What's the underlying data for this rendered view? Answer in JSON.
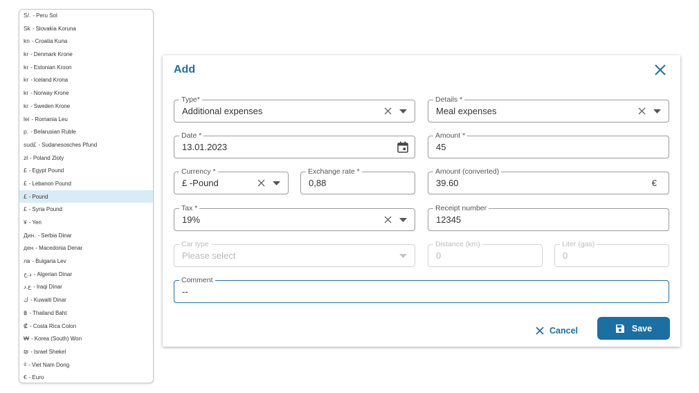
{
  "currency_list": {
    "selected_index": 14,
    "items": [
      {
        "symbol": "S/.",
        "name": "Peru Sol"
      },
      {
        "symbol": "Sk",
        "name": "Slovakia Koruna"
      },
      {
        "symbol": "kn",
        "name": "Croatia Kuna"
      },
      {
        "symbol": "kr",
        "name": "Denmark Krone"
      },
      {
        "symbol": "kr",
        "name": "Estonian Kroon"
      },
      {
        "symbol": "kr",
        "name": "Iceland Krona"
      },
      {
        "symbol": "kr",
        "name": "Norway Krone"
      },
      {
        "symbol": "kr",
        "name": "Sweden Krone"
      },
      {
        "symbol": "lei",
        "name": "Romania Leu"
      },
      {
        "symbol": "p.",
        "name": "Belarusian Ruble"
      },
      {
        "symbol": "sud£",
        "name": "Sudanesosches Pfund"
      },
      {
        "symbol": "zł",
        "name": "Poland Zloty"
      },
      {
        "symbol": "£",
        "name": "Egypt Pound"
      },
      {
        "symbol": "£",
        "name": "Lebanon Pound"
      },
      {
        "symbol": "£",
        "name": "Pound"
      },
      {
        "symbol": "£",
        "name": "Syria Pound"
      },
      {
        "symbol": "¥",
        "name": "Yen"
      },
      {
        "symbol": "Дин.",
        "name": "Serbia Dinar"
      },
      {
        "symbol": "ден",
        "name": "Macedonia Denar"
      },
      {
        "symbol": "лв",
        "name": "Bulgaria Lev"
      },
      {
        "symbol": "د.ج",
        "name": "Algerian Dinar"
      },
      {
        "symbol": "ع.د",
        "name": "Iraqi Dinar"
      },
      {
        "symbol": "ك",
        "name": "Kuwaiti Dinar"
      },
      {
        "symbol": "฿",
        "name": "Thailand Baht"
      },
      {
        "symbol": "₡",
        "name": "Costa Rica Colon"
      },
      {
        "symbol": "₩",
        "name": "Korea (South) Won"
      },
      {
        "symbol": "₪",
        "name": "Israel Shekel"
      },
      {
        "symbol": "₫",
        "name": "Viet Nam Dong"
      },
      {
        "symbol": "€",
        "name": "Euro"
      }
    ]
  },
  "dialog": {
    "title": "Add",
    "type": {
      "label": "Type*",
      "value": "Additional expenses"
    },
    "details": {
      "label": "Details *",
      "value": "Meal expenses"
    },
    "date": {
      "label": "Date *",
      "value": "13.01.2023"
    },
    "amount": {
      "label": "Amount *",
      "value": "45"
    },
    "currency": {
      "label": "Currency *",
      "value": "£ -Pound"
    },
    "exchange_rate": {
      "label": "Exchange rate *",
      "value": "0,88"
    },
    "amount_converted": {
      "label": "Amount (converted)",
      "value": "39.60",
      "suffix": "€"
    },
    "tax": {
      "label": "Tax *",
      "value": "19%"
    },
    "receipt_number": {
      "label": "Receipt number",
      "value": "12345"
    },
    "car_type": {
      "label": "Car type",
      "placeholder": "Please select"
    },
    "distance": {
      "label": "Distance (km)",
      "value": "0"
    },
    "liter": {
      "label": "Liter (gas)",
      "value": "0"
    },
    "comment": {
      "label": "Comment",
      "value": "--"
    },
    "cancel_label": "Cancel",
    "save_label": "Save"
  },
  "colors": {
    "accent": "#1c6fa3",
    "selected_row": "#d9ecf5",
    "border": "#9a9a9a",
    "disabled": "#d2d2d2"
  },
  "icons": [
    "close-icon",
    "clear-icon",
    "chevron-down-icon",
    "calendar-icon",
    "save-icon"
  ]
}
